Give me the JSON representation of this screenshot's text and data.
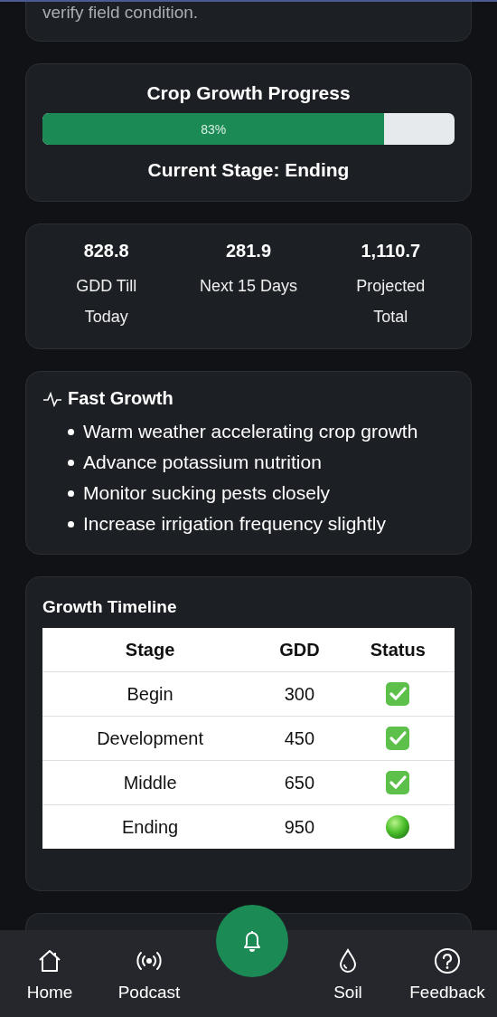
{
  "advisory": {
    "text": "verify field condition."
  },
  "progress": {
    "title": "Crop Growth Progress",
    "level": 0.83,
    "label": "83%",
    "stage": "Current Stage: Ending"
  },
  "stats": [
    {
      "value": "828.8",
      "label": "GDD Till Today"
    },
    {
      "value": "281.9",
      "label": "Next 15 Days"
    },
    {
      "value": "1,110.7",
      "label": "Projected Total"
    }
  ],
  "insight": {
    "title": "Fast Growth",
    "items": [
      "Warm weather accelerating crop growth",
      "Advance potassium nutrition",
      "Monitor sucking pests closely",
      "Increase irrigation frequency slightly"
    ]
  },
  "timeline": {
    "title": "Growth Timeline",
    "columns": [
      "Stage",
      "GDD",
      "Status"
    ],
    "rows": [
      {
        "stage": "Begin",
        "gdd": "300",
        "kind": "done"
      },
      {
        "stage": "Development",
        "gdd": "450",
        "kind": "done"
      },
      {
        "stage": "Middle",
        "gdd": "650",
        "kind": "done"
      },
      {
        "stage": "Ending",
        "gdd": "950",
        "kind": "current"
      }
    ]
  },
  "nav": [
    {
      "kind": "home",
      "label": "Home"
    },
    {
      "kind": "podcast",
      "label": "Podcast"
    },
    {
      "kind": "bell"
    },
    {
      "kind": "soil",
      "label": "Soil"
    },
    {
      "kind": "feedback",
      "label": "Feedback"
    }
  ]
}
